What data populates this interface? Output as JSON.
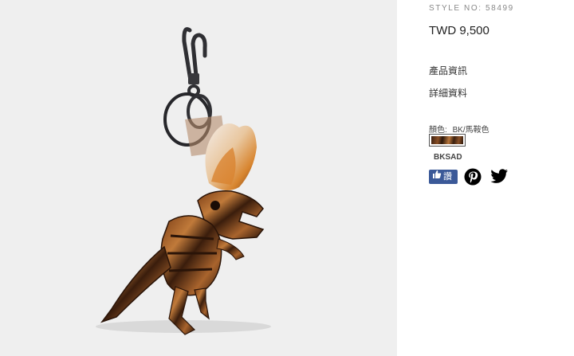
{
  "product": {
    "image_alt": "Rexy dinosaur bag charm"
  },
  "details": {
    "style_no": "STYLE NO: 58499",
    "price": "TWD 9,500",
    "product_info_link": "產品資訊",
    "detail_info_link": "詳細資料",
    "color_label": "顏色:",
    "color_value": "BK/馬鞍色",
    "color_code": "BKSAD"
  },
  "share": {
    "facebook_label": "讚",
    "facebook_icon": "thumbs-up-icon",
    "pinterest_icon": "pinterest-icon",
    "twitter_icon": "twitter-icon"
  },
  "colors": {
    "image_background": "#efefef",
    "facebook_blue": "#3b5998",
    "pinterest": "#000000",
    "twitter": "#000000"
  }
}
